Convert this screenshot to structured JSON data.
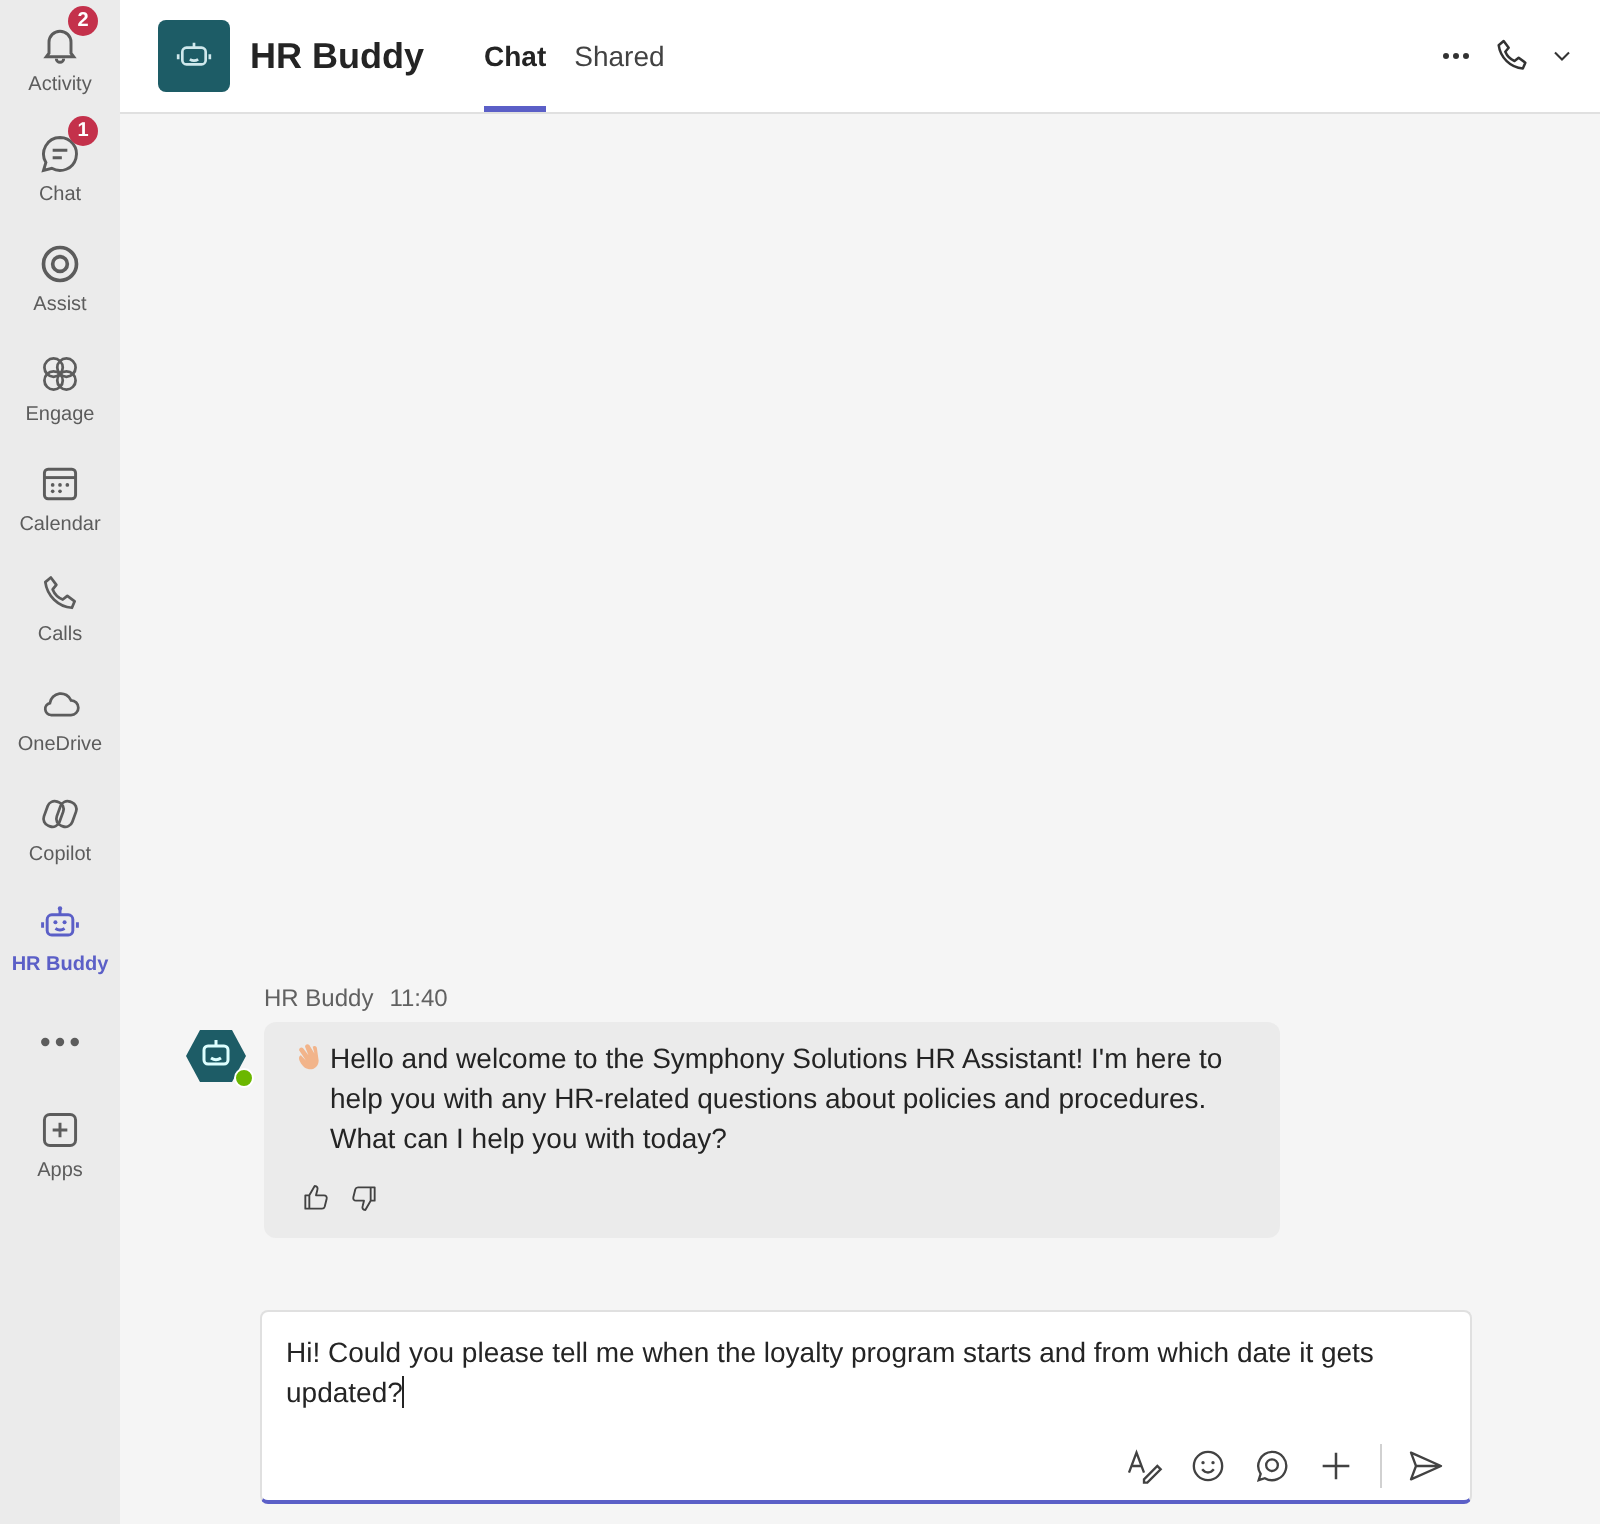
{
  "sidebar": {
    "items": [
      {
        "label": "Activity",
        "kind": "bell",
        "badge": "2",
        "selected": false
      },
      {
        "label": "Chat",
        "kind": "chat",
        "badge": "1",
        "selected": false
      },
      {
        "label": "Assist",
        "kind": "ring",
        "selected": false
      },
      {
        "label": "Engage",
        "kind": "engage",
        "selected": false
      },
      {
        "label": "Calendar",
        "kind": "calendar",
        "selected": false
      },
      {
        "label": "Calls",
        "kind": "phone",
        "selected": false
      },
      {
        "label": "OneDrive",
        "kind": "cloud",
        "selected": false
      },
      {
        "label": "Copilot",
        "kind": "copilot",
        "selected": false
      },
      {
        "label": "HR Buddy",
        "kind": "bot",
        "selected": true
      },
      {
        "kind": "more",
        "selected": false
      },
      {
        "label": "Apps",
        "kind": "plus",
        "selected": false
      }
    ]
  },
  "header": {
    "title": "HR Buddy",
    "tabs": [
      {
        "label": "Chat",
        "selected": true
      },
      {
        "label": "Shared",
        "selected": false
      }
    ]
  },
  "messages": [
    {
      "sender": "HR Buddy",
      "time": "11:40",
      "text": "Hello and welcome to the Symphony Solutions HR Assistant! I'm here to help you with any HR-related questions about policies and procedures. What can I help you with today?",
      "online": true
    }
  ],
  "composer": {
    "value": "Hi! Could you please tell me when the loyalty program starts and from which date it gets updated?"
  }
}
